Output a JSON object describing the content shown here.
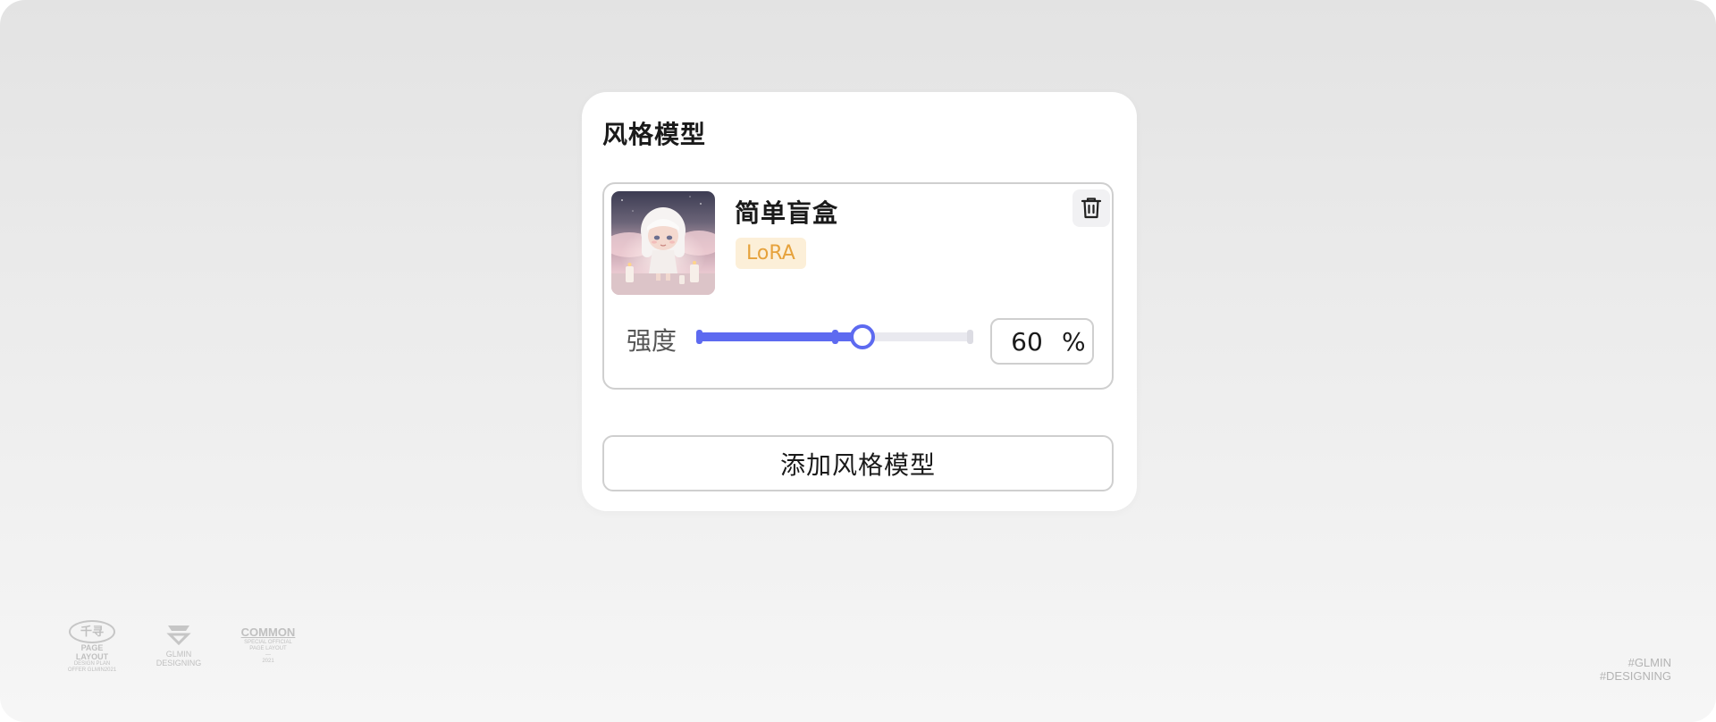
{
  "panel": {
    "title": "风格模型"
  },
  "model_card": {
    "name": "简单盲盒",
    "badge": "LoRA",
    "thumbnail_icon": "blind-box-doll-thumbnail"
  },
  "strength": {
    "label": "强度",
    "value": "60",
    "unit": "%",
    "fraction": 0.6,
    "marker_fraction": 0.5
  },
  "add_button": {
    "label": "添加风格模型"
  },
  "footer": {
    "logo1": {
      "mark": "千寻",
      "line1": "PAGE LAYOUT",
      "line2": "DESIGN PLAN",
      "line3": "OFFER GLMIN2021"
    },
    "logo2": {
      "line1": "GLMIN",
      "line2": "DESIGNING"
    },
    "logo3": {
      "mark": "COMMON",
      "line1": "SPECIAL OFFICIAL",
      "line2": "PAGE LAYOUT",
      "line3": "—",
      "line4": "2021"
    },
    "tags": [
      "#GLMIN",
      "#DESIGNING"
    ]
  },
  "colors": {
    "accent": "#5d6af0",
    "badge_text": "#e6a23c",
    "badge_bg": "#fcefd8"
  }
}
